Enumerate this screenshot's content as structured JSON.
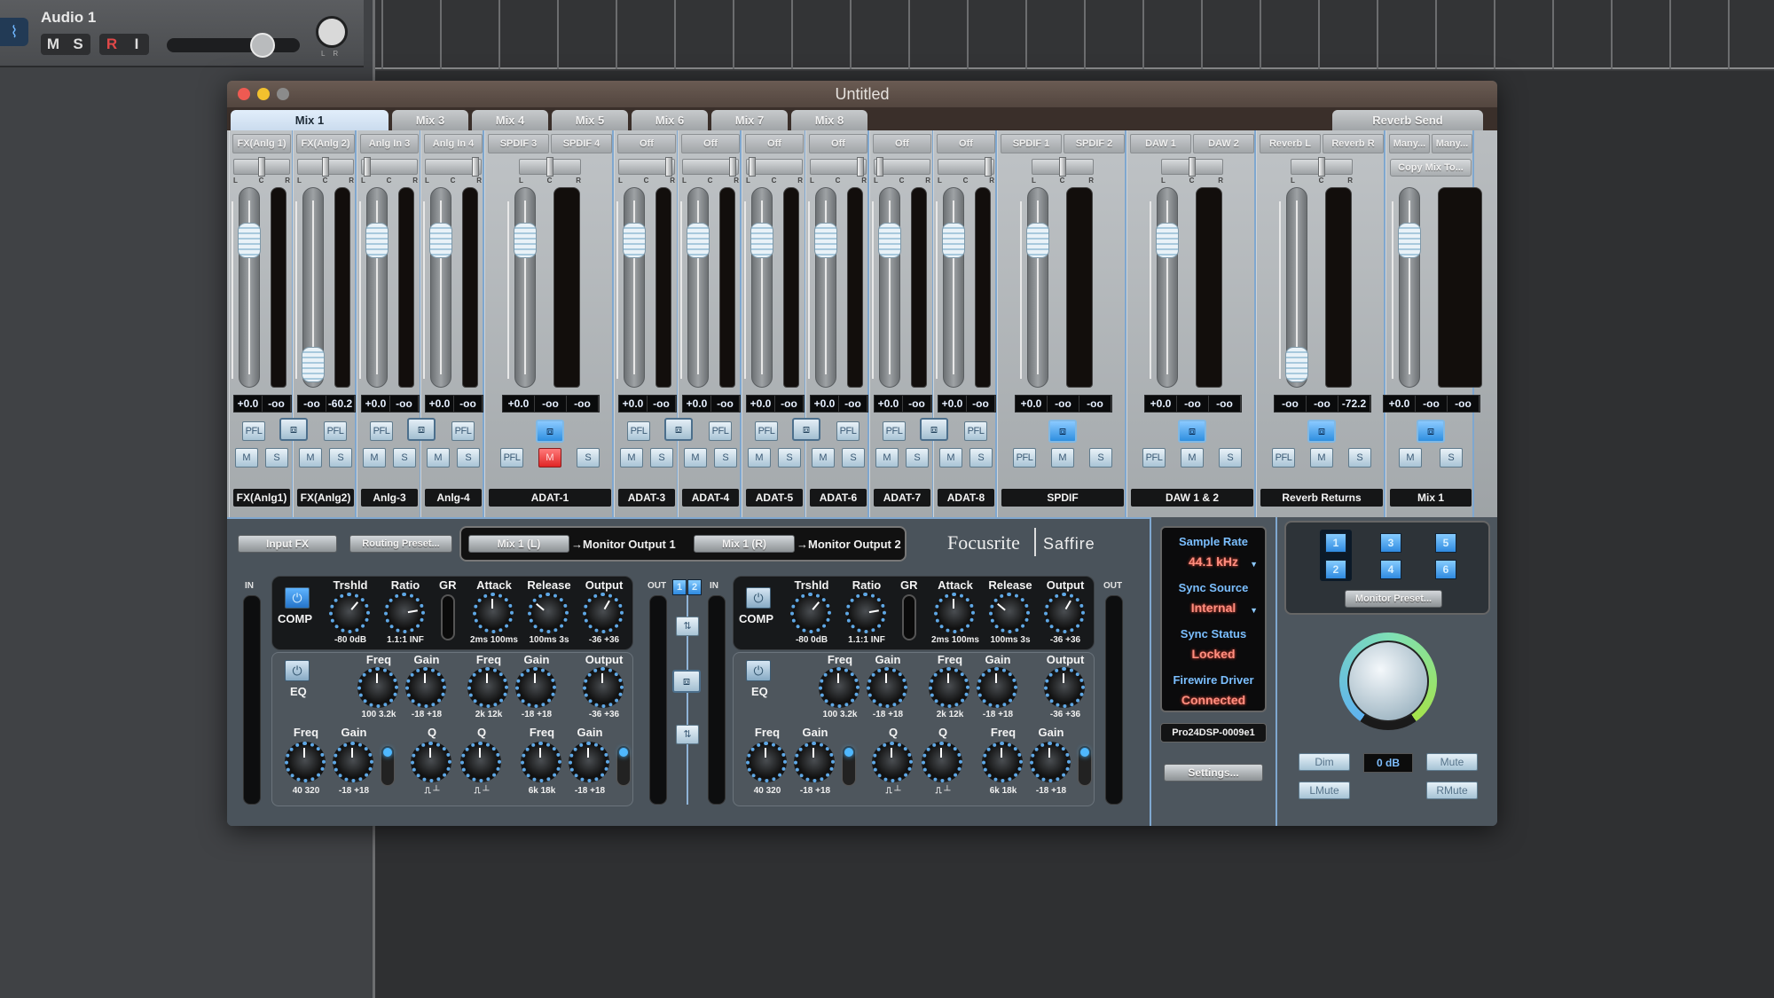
{
  "daw": {
    "track_name": "Audio 1",
    "track_icon": "waveform-icon",
    "buttons": [
      "M",
      "S",
      "R",
      "I"
    ],
    "volume_fraction": 0.78,
    "pan_labels": [
      "L",
      "R"
    ]
  },
  "window": {
    "title": "Untitled",
    "tabs": [
      "Mix 1",
      "Mix 3",
      "Mix 4",
      "Mix 5",
      "Mix 6",
      "Mix 7",
      "Mix 8"
    ],
    "active_tab": "Mix 1",
    "right_tab": "Reverb Send"
  },
  "mixer": {
    "pan_labels": {
      "l": "L",
      "c": "C",
      "r": "R"
    },
    "pfl_label": "PFL",
    "mute_label": "M",
    "solo_label": "S",
    "link_icon": "stereo-link-icon",
    "copy_mix_label": "Copy Mix To...",
    "groups": [
      {
        "name": "FX(Anlg1)",
        "sources": [
          "FX(Anlg 1)"
        ],
        "stereo": false,
        "readouts": [
          "+0.0",
          "-oo"
        ],
        "pan": "center",
        "fader_db": 0.0,
        "mute": false
      },
      {
        "name": "FX(Anlg2)",
        "sources": [
          "FX(Anlg 2)"
        ],
        "stereo": false,
        "readouts": [
          "-oo",
          "-60.2"
        ],
        "pan": "center",
        "fader_db": "-inf",
        "mute": false
      },
      {
        "name": "Anlg-3",
        "sources": [
          "Anlg In 3"
        ],
        "stereo": false,
        "readouts": [
          "+0.0",
          "-oo"
        ],
        "pan": "left",
        "fader_db": 0.0,
        "mute": false
      },
      {
        "name": "Anlg-4",
        "sources": [
          "Anlg In 4"
        ],
        "stereo": false,
        "readouts": [
          "+0.0",
          "-oo"
        ],
        "pan": "right",
        "fader_db": 0.0,
        "mute": false
      },
      {
        "name": "ADAT-1",
        "sources": [
          "SPDIF 3",
          "SPDIF 4"
        ],
        "stereo": true,
        "readouts": [
          "+0.0",
          "-oo",
          "-oo"
        ],
        "pan": "center",
        "fader_db": 0.0,
        "mute": true
      },
      {
        "name": "ADAT-3",
        "sources": [
          "Off"
        ],
        "stereo": false,
        "readouts": [
          "+0.0",
          "-oo"
        ],
        "pan": "right",
        "fader_db": 0.0,
        "mute": false
      },
      {
        "name": "ADAT-4",
        "sources": [
          "Off"
        ],
        "stereo": false,
        "readouts": [
          "+0.0",
          "-oo"
        ],
        "pan": "right",
        "fader_db": 0.0,
        "mute": false
      },
      {
        "name": "ADAT-5",
        "sources": [
          "Off"
        ],
        "stereo": false,
        "readouts": [
          "+0.0",
          "-oo"
        ],
        "pan": "left",
        "fader_db": 0.0,
        "mute": false
      },
      {
        "name": "ADAT-6",
        "sources": [
          "Off"
        ],
        "stereo": false,
        "readouts": [
          "+0.0",
          "-oo"
        ],
        "pan": "right",
        "fader_db": 0.0,
        "mute": false
      },
      {
        "name": "ADAT-7",
        "sources": [
          "Off"
        ],
        "stereo": false,
        "readouts": [
          "+0.0",
          "-oo"
        ],
        "pan": "left",
        "fader_db": 0.0,
        "mute": false
      },
      {
        "name": "ADAT-8",
        "sources": [
          "Off"
        ],
        "stereo": false,
        "readouts": [
          "+0.0",
          "-oo"
        ],
        "pan": "right",
        "fader_db": 0.0,
        "mute": false
      },
      {
        "name": "SPDIF",
        "sources": [
          "SPDIF 1",
          "SPDIF 2"
        ],
        "stereo": true,
        "readouts": [
          "+0.0",
          "-oo",
          "-oo"
        ],
        "pan": "center",
        "fader_db": 0.0,
        "mute": false
      },
      {
        "name": "DAW 1 & 2",
        "sources": [
          "DAW 1",
          "DAW 2"
        ],
        "stereo": true,
        "readouts": [
          "+0.0",
          "-oo",
          "-oo"
        ],
        "pan": "center",
        "fader_db": 0.0,
        "mute": false
      },
      {
        "name": "Reverb Returns",
        "sources": [
          "Reverb L",
          "Reverb R"
        ],
        "stereo": true,
        "readouts": [
          "-oo",
          "-oo",
          "-72.2"
        ],
        "pan": "center",
        "fader_db": "-inf",
        "mute": false
      },
      {
        "name": "Mix 1",
        "sources": [
          "Many...",
          "Many..."
        ],
        "stereo": true,
        "readouts": [
          "+0.0",
          "-oo",
          "-oo"
        ],
        "pan": null,
        "fader_db": 0.0,
        "mute": false,
        "master": true
      }
    ]
  },
  "routing": {
    "input_fx": "Input FX",
    "routing_preset": "Routing Preset...",
    "left_src": "Mix 1 (L)",
    "left_dest": "→Monitor Output 1",
    "right_src": "Mix 1 (R)",
    "right_dest": "→Monitor Output 2",
    "brand": "Focusrite",
    "product": "Saffire"
  },
  "fx": {
    "in_label": "IN",
    "out_label": "OUT",
    "channel_buttons": [
      "1",
      "2"
    ],
    "comp_label": "COMP",
    "eq_label": "EQ",
    "gr_label": "GR",
    "comp_knobs": [
      {
        "label": "Trshld",
        "range": "-80  0dB"
      },
      {
        "label": "Ratio",
        "range": "1.1:1   INF"
      },
      {
        "label": "Attack",
        "range": "2ms 100ms"
      },
      {
        "label": "Release",
        "range": "100ms  3s"
      },
      {
        "label": "Output",
        "range": "-36 +36"
      }
    ],
    "eq_mid": [
      {
        "label": "Freq",
        "range": "100 3.2k"
      },
      {
        "label": "Gain",
        "range": "-18  +18"
      },
      {
        "label": "Freq",
        "range": "2k   12k"
      },
      {
        "label": "Gain",
        "range": "-18  +18"
      },
      {
        "label": "Output",
        "range": "-36 +36"
      }
    ],
    "eq_low": [
      {
        "label": "Freq",
        "range": "40 320"
      },
      {
        "label": "Gain",
        "range": "-18  +18"
      },
      {
        "label": "Q",
        "range": "⎍    ┴"
      },
      {
        "label": "Q",
        "range": "⎍    ┴"
      },
      {
        "label": "Freq",
        "range": "6k   18k"
      },
      {
        "label": "Gain",
        "range": "-18  +18"
      }
    ]
  },
  "status": {
    "sample_rate_label": "Sample Rate",
    "sample_rate": "44.1 kHz",
    "sync_source_label": "Sync Source",
    "sync_source": "Internal",
    "sync_status_label": "Sync Status",
    "sync_status": "Locked",
    "driver_label": "Firewire Driver",
    "driver_status": "Connected",
    "device": "Pro24DSP-0009e1",
    "settings": "Settings..."
  },
  "monitor": {
    "presets": [
      "1",
      "2",
      "3",
      "4",
      "5",
      "6"
    ],
    "active_preset": "1",
    "preset_button": "Monitor Preset...",
    "volume_readout": "0 dB",
    "dim": "Dim",
    "mute": "Mute",
    "lmute": "LMute",
    "rmute": "RMute"
  }
}
